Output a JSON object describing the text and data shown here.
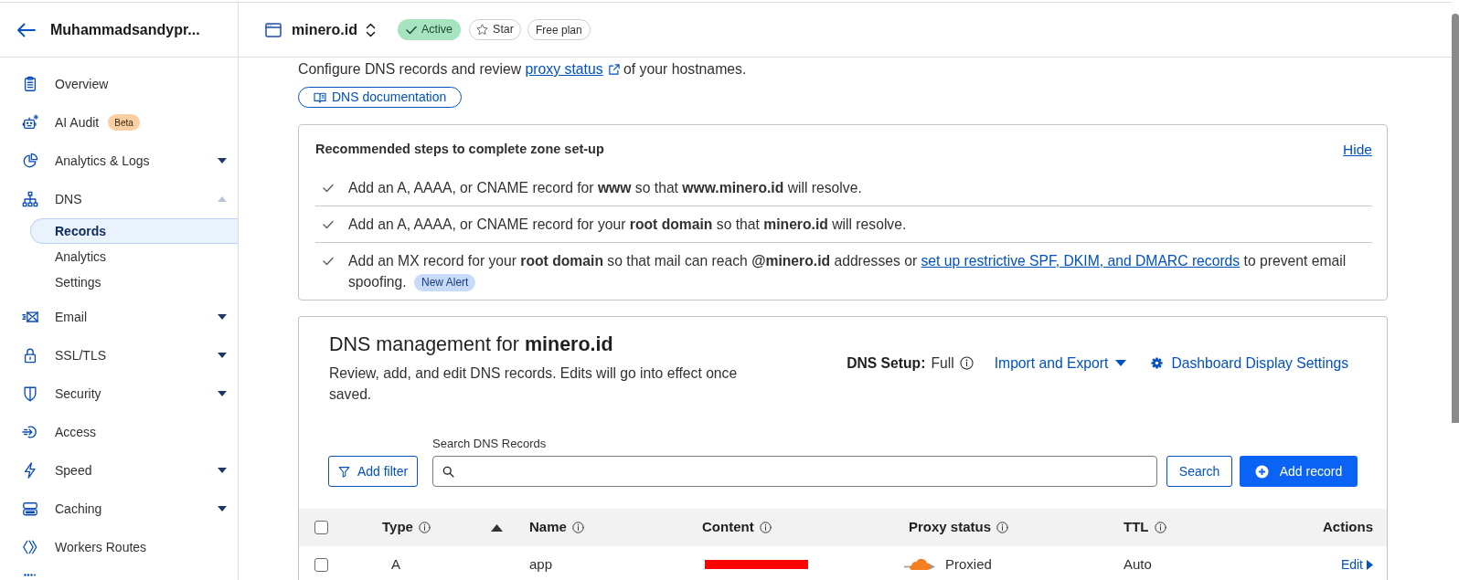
{
  "sidebar": {
    "account": "Muhammadsandypr...",
    "items": [
      {
        "label": "Overview",
        "kind": "link",
        "selected": false
      },
      {
        "label": "AI Audit",
        "kind": "link",
        "selected": false,
        "badge": "Beta"
      },
      {
        "label": "Analytics & Logs",
        "kind": "group",
        "selected": false,
        "expanded": false
      },
      {
        "label": "DNS",
        "kind": "group",
        "selected": false,
        "expanded": true,
        "children": [
          {
            "label": "Records",
            "selected": true
          },
          {
            "label": "Analytics",
            "selected": false
          },
          {
            "label": "Settings",
            "selected": false
          }
        ]
      },
      {
        "label": "Email",
        "kind": "group",
        "selected": false,
        "expanded": false
      },
      {
        "label": "SSL/TLS",
        "kind": "group",
        "selected": false,
        "expanded": false
      },
      {
        "label": "Security",
        "kind": "group",
        "selected": false,
        "expanded": false
      },
      {
        "label": "Access",
        "kind": "link",
        "selected": false
      },
      {
        "label": "Speed",
        "kind": "group",
        "selected": false,
        "expanded": false
      },
      {
        "label": "Caching",
        "kind": "group",
        "selected": false,
        "expanded": false
      },
      {
        "label": "Workers Routes",
        "kind": "link",
        "selected": false
      }
    ]
  },
  "zone_header": {
    "zone": "minero.id",
    "badges": [
      {
        "kind": "status",
        "label": "Active"
      },
      {
        "kind": "star",
        "label": "Star",
        "starred": false
      },
      {
        "kind": "plan",
        "label": "Free plan"
      }
    ]
  },
  "intro": {
    "text": "Configure DNS records and review ",
    "link": "proxy status",
    "after": " of your hostnames.",
    "button": "DNS documentation"
  },
  "setup_steps": {
    "title": "Recommended steps to complete zone set-up",
    "hide": "Hide",
    "items": [
      {
        "text": "Add an A, AAAA, or CNAME record for **www** so that **www.minero.id** will resolve."
      },
      {
        "text": "Add an A, AAAA, or CNAME record for your **root domain** so that **minero.id** will resolve."
      },
      {
        "text": "Add an MX record for your **root domain** so that mail can reach **@minero.id** addresses or ",
        "link": "set up restrictive SPF, DKIM, and DMARC records",
        "after": " to prevent email spoofing.",
        "badge": "New Alert"
      }
    ]
  },
  "dns_management": {
    "title": "DNS management for **minero.id**",
    "description": "Review, add, and edit DNS records. Edits will go into effect once saved.",
    "setup_label": "DNS Setup:",
    "setup_value": "Full",
    "import_export": "Import and Export",
    "display_settings": "Dashboard Display Settings",
    "add_filter": "Add filter",
    "search_label": "Search DNS Records",
    "search_button": "Search",
    "add_record": "Add record",
    "table": {
      "all_selected": false,
      "columns": [
        {
          "label": "Type",
          "info": true,
          "sorted": true
        },
        {
          "label": "Name",
          "info": true,
          "sorted": false
        },
        {
          "label": "Content",
          "info": true,
          "sorted": false
        },
        {
          "label": "Proxy status",
          "info": true,
          "sorted": false
        },
        {
          "label": "TTL",
          "info": true,
          "sorted": false
        },
        {
          "label": "Actions",
          "info": false,
          "sorted": false
        }
      ],
      "rows": [
        {
          "selected": false,
          "type": "A",
          "name": "app",
          "content_redacted": true,
          "proxied": true,
          "proxy_status": "Proxied",
          "ttl": "Auto",
          "action": "Edit"
        }
      ]
    }
  }
}
